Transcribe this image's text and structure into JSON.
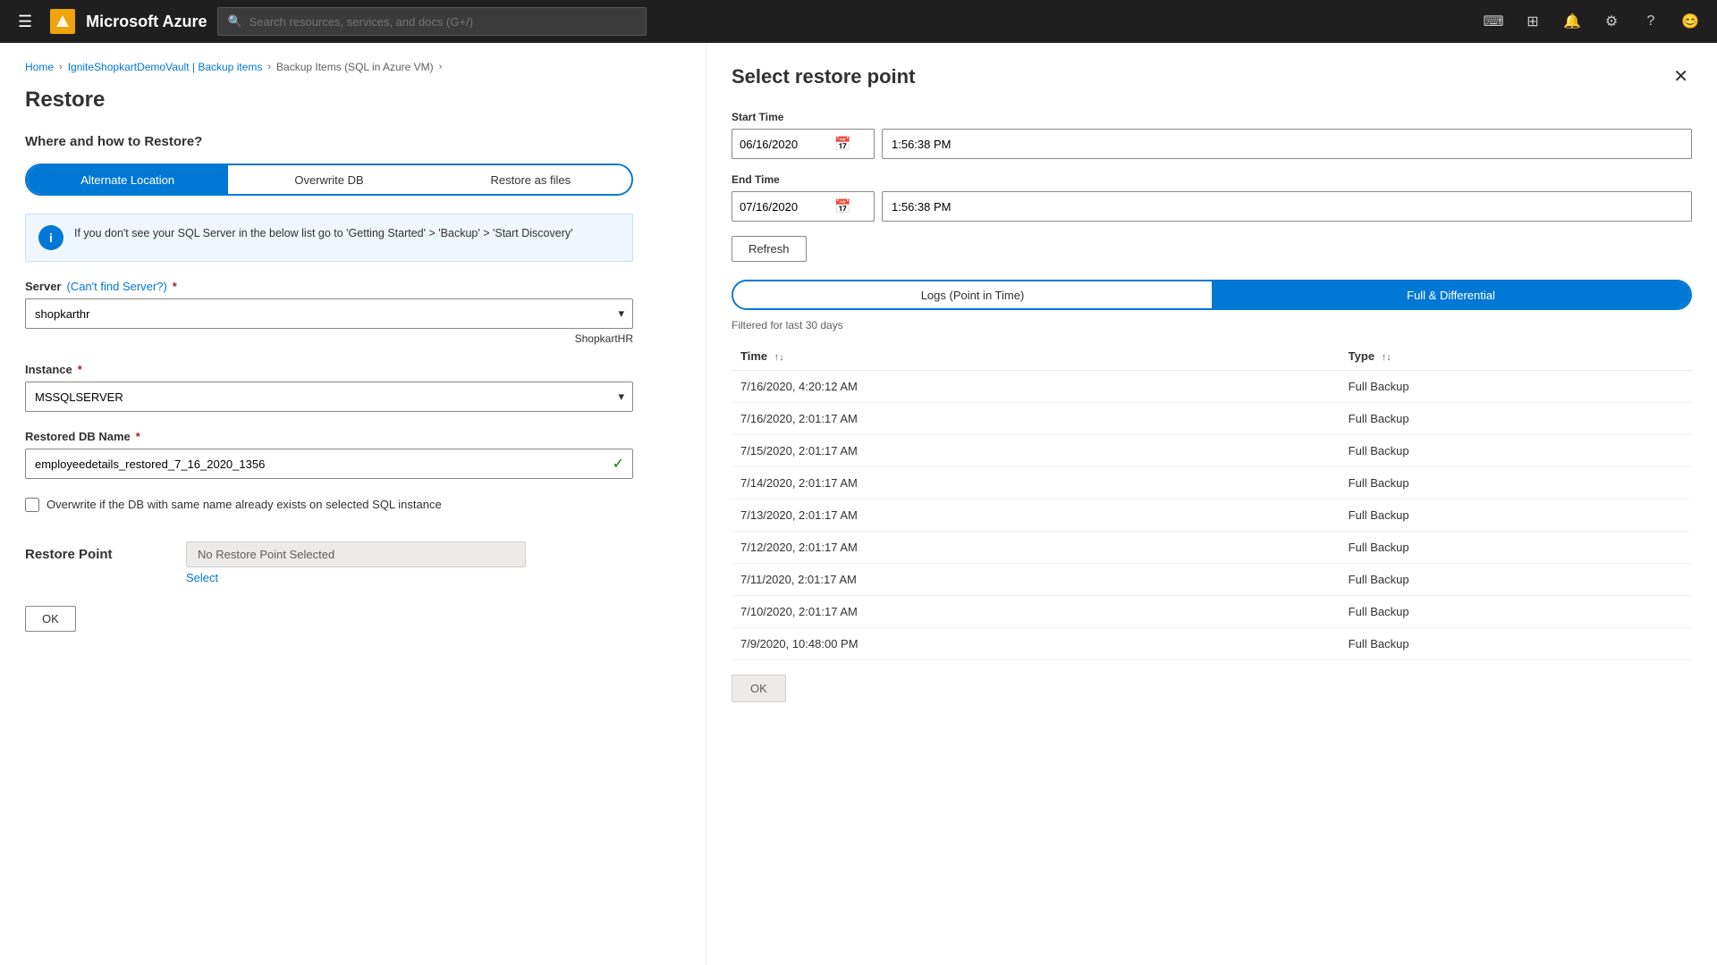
{
  "nav": {
    "brand": "Microsoft Azure",
    "search_placeholder": "Search resources, services, and docs (G+/)",
    "hamburger_label": "☰"
  },
  "breadcrumb": {
    "items": [
      "Home",
      "IgniteShopkartDemoVault | Backup items",
      "Backup Items (SQL in Azure VM)"
    ]
  },
  "restore": {
    "page_title": "Restore",
    "section_title": "Where and how to Restore?",
    "toggle_options": [
      "Alternate Location",
      "Overwrite DB",
      "Restore as files"
    ],
    "active_toggle": 0,
    "info_text": "If you don't see your SQL Server in the below list go to 'Getting Started' > 'Backup' > 'Start Discovery'",
    "server_label": "Server",
    "server_link_text": "(Can't find Server?)",
    "server_value": "shopkarthr",
    "server_hint": "ShopkartHR",
    "instance_label": "Instance",
    "instance_value": "MSSQLSERVER",
    "db_name_label": "Restored DB Name",
    "db_name_value": "employeedetails_restored_7_16_2020_1356",
    "overwrite_checkbox_label": "Overwrite if the DB with same name already exists on selected SQL instance",
    "restore_point_label": "Restore Point",
    "restore_point_value": "No Restore Point Selected",
    "select_link": "Select",
    "ok_button": "OK"
  },
  "restore_point_panel": {
    "title": "Select restore point",
    "start_time_label": "Start Time",
    "start_date": "06/16/2020",
    "start_time": "1:56:38 PM",
    "end_time_label": "End Time",
    "end_date": "07/16/2020",
    "end_time": "1:56:38 PM",
    "refresh_button": "Refresh",
    "tab_logs": "Logs (Point in Time)",
    "tab_full": "Full & Differential",
    "active_tab": 1,
    "filter_note": "Filtered for last 30 days",
    "table_headers": [
      "Time",
      "Type"
    ],
    "table_rows": [
      {
        "time": "7/16/2020, 4:20:12 AM",
        "type": "Full Backup"
      },
      {
        "time": "7/16/2020, 2:01:17 AM",
        "type": "Full Backup"
      },
      {
        "time": "7/15/2020, 2:01:17 AM",
        "type": "Full Backup"
      },
      {
        "time": "7/14/2020, 2:01:17 AM",
        "type": "Full Backup"
      },
      {
        "time": "7/13/2020, 2:01:17 AM",
        "type": "Full Backup"
      },
      {
        "time": "7/12/2020, 2:01:17 AM",
        "type": "Full Backup"
      },
      {
        "time": "7/11/2020, 2:01:17 AM",
        "type": "Full Backup"
      },
      {
        "time": "7/10/2020, 2:01:17 AM",
        "type": "Full Backup"
      },
      {
        "time": "7/9/2020, 10:48:00 PM",
        "type": "Full Backup"
      }
    ],
    "ok_button": "OK"
  }
}
